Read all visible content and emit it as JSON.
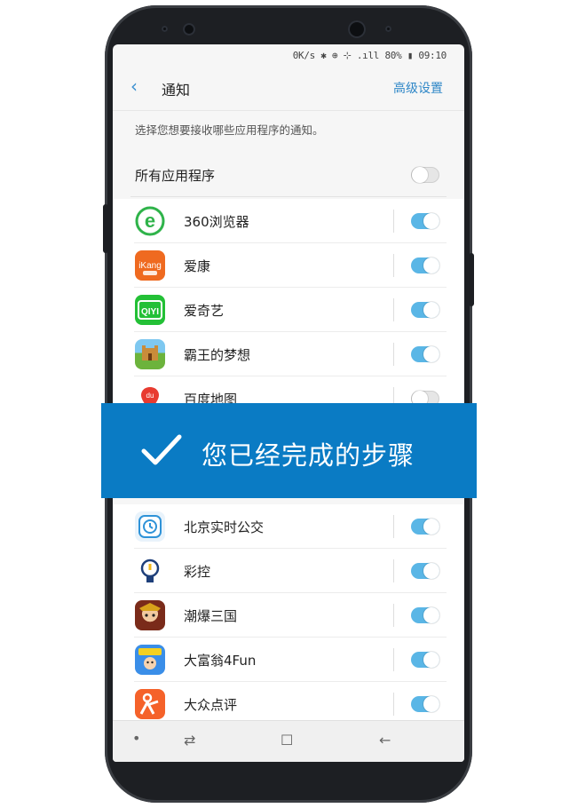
{
  "status_bar": {
    "text": "0K/s ✱ ⊕ ⊹ .ıll 80% ▮ 09:10"
  },
  "app_bar": {
    "back_glyph": "‹",
    "title": "通知",
    "action": "高级设置"
  },
  "description": "选择您想要接收哪些应用程序的通知。",
  "all_apps": {
    "label": "所有应用程序",
    "enabled": false
  },
  "apps": [
    {
      "name": "360浏览器",
      "enabled": true,
      "icon": "e"
    },
    {
      "name": "爱康",
      "enabled": true,
      "icon": "iKang"
    },
    {
      "name": "爱奇艺",
      "enabled": true,
      "icon": "QIYI"
    },
    {
      "name": "霸王的梦想",
      "enabled": true,
      "icon": ""
    },
    {
      "name": "百度地图",
      "enabled": false,
      "icon": "du"
    },
    {
      "name": "北京实时公交",
      "enabled": true,
      "icon": ""
    },
    {
      "name": "彩控",
      "enabled": true,
      "icon": ""
    },
    {
      "name": "潮爆三国",
      "enabled": true,
      "icon": ""
    },
    {
      "name": "大富翁4Fun",
      "enabled": true,
      "icon": ""
    },
    {
      "name": "大众点评",
      "enabled": true,
      "icon": ""
    }
  ],
  "banner": {
    "text": "您已经完成的步骤"
  },
  "nav_bar": {
    "dot": "•",
    "recents": "⇄",
    "home": "☐",
    "back": "←"
  },
  "colors": {
    "accent": "#2f87c7",
    "toggle_on": "#5ab6e6",
    "banner": "#0a7bc4"
  }
}
